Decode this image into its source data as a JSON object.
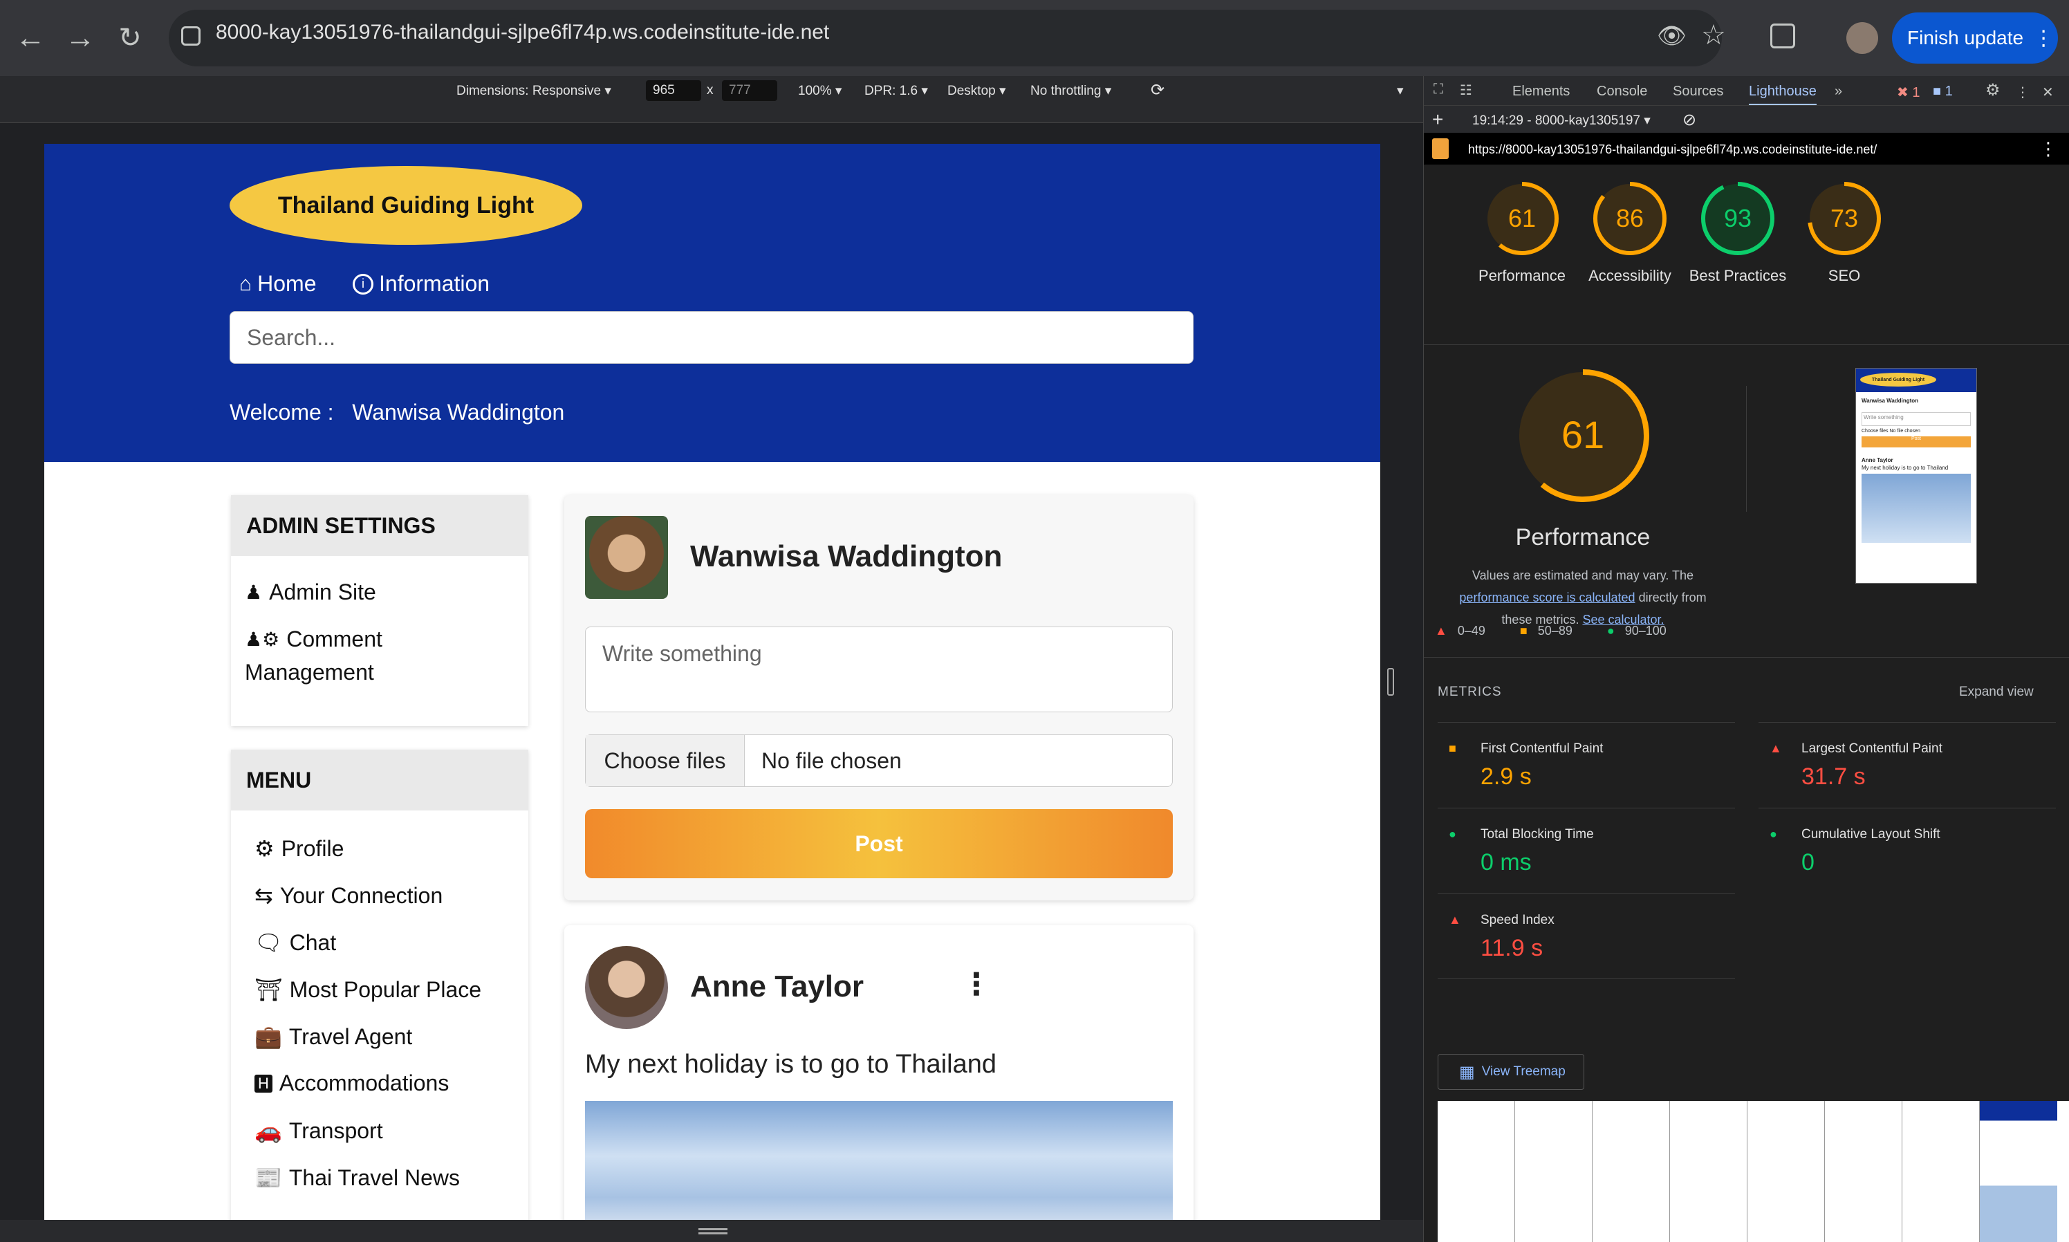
{
  "browser": {
    "url": "8000-kay13051976-thailandgui-sjlpe6fl74p.ws.codeinstitute-ide.net",
    "finish_update": "Finish update"
  },
  "device_toolbar": {
    "dimensions": "Dimensions: Responsive",
    "width": "965",
    "x": "x",
    "height": "777",
    "zoom": "100%",
    "dpr": "DPR: 1.6",
    "mode": "Desktop",
    "throttle": "No throttling"
  },
  "site": {
    "logo": "Thailand Guiding Light",
    "nav": [
      "Home",
      "Information"
    ],
    "search_placeholder": "Search...",
    "welcome_label": "Welcome :",
    "welcome_user": "Wanwisa Waddington",
    "admin": {
      "title": "ADMIN SETTINGS",
      "items": [
        "Admin Site",
        "Comment",
        "Management"
      ]
    },
    "menu": {
      "title": "MENU",
      "items": [
        "Profile",
        "Your Connection",
        "Chat",
        "Most Popular Place",
        "Travel Agent",
        "Accommodations",
        "Transport",
        "Thai Travel News"
      ]
    },
    "composer": {
      "user": "Wanwisa Waddington",
      "placeholder": "Write something",
      "choose_files": "Choose files",
      "no_file": "No file chosen",
      "post": "Post"
    },
    "post": {
      "user": "Anne Taylor",
      "text": "My next holiday is to go to Thailand"
    }
  },
  "devtools": {
    "tabs": [
      "Elements",
      "Console",
      "Sources",
      "Lighthouse"
    ],
    "errors": "1",
    "messages": "1",
    "report_time": "19:14:29 - 8000-kay1305197",
    "lh_url": "https://8000-kay13051976-thailandgui-sjlpe6fl74p.ws.codeinstitute-ide.net/",
    "scores": [
      {
        "label": "Performance",
        "value": 61,
        "color": "#ffa400"
      },
      {
        "label": "Accessibility",
        "value": 86,
        "color": "#ffa400"
      },
      {
        "label": "Best Practices",
        "value": 93,
        "color": "#0cce6b"
      },
      {
        "label": "SEO",
        "value": 73,
        "color": "#ffa400"
      }
    ],
    "big_score": {
      "label": "Performance",
      "value": 61
    },
    "note_1": "Values are estimated and may vary. The",
    "note_link": "performance score is calculated",
    "note_2": "directly from",
    "note_3": "these metrics.",
    "note_link2": "See calculator.",
    "legend": [
      "0–49",
      "50–89",
      "90–100"
    ],
    "metrics_title": "METRICS",
    "expand": "Expand view",
    "metrics": [
      {
        "name": "First Contentful Paint",
        "value": "2.9 s",
        "status": "average"
      },
      {
        "name": "Largest Contentful Paint",
        "value": "31.7 s",
        "status": "fail"
      },
      {
        "name": "Total Blocking Time",
        "value": "0 ms",
        "status": "pass"
      },
      {
        "name": "Cumulative Layout Shift",
        "value": "0",
        "status": "pass"
      },
      {
        "name": "Speed Index",
        "value": "11.9 s",
        "status": "fail"
      }
    ],
    "treemap": "View Treemap",
    "thumb": {
      "logo": "Thailand Guiding Light",
      "user": "Wanwisa Waddington",
      "write": "Write something",
      "choose": "Choose files",
      "no_file": "No file chosen",
      "post": "Post",
      "anne": "Anne Taylor",
      "text": "My next holiday is to go to Thailand"
    }
  }
}
